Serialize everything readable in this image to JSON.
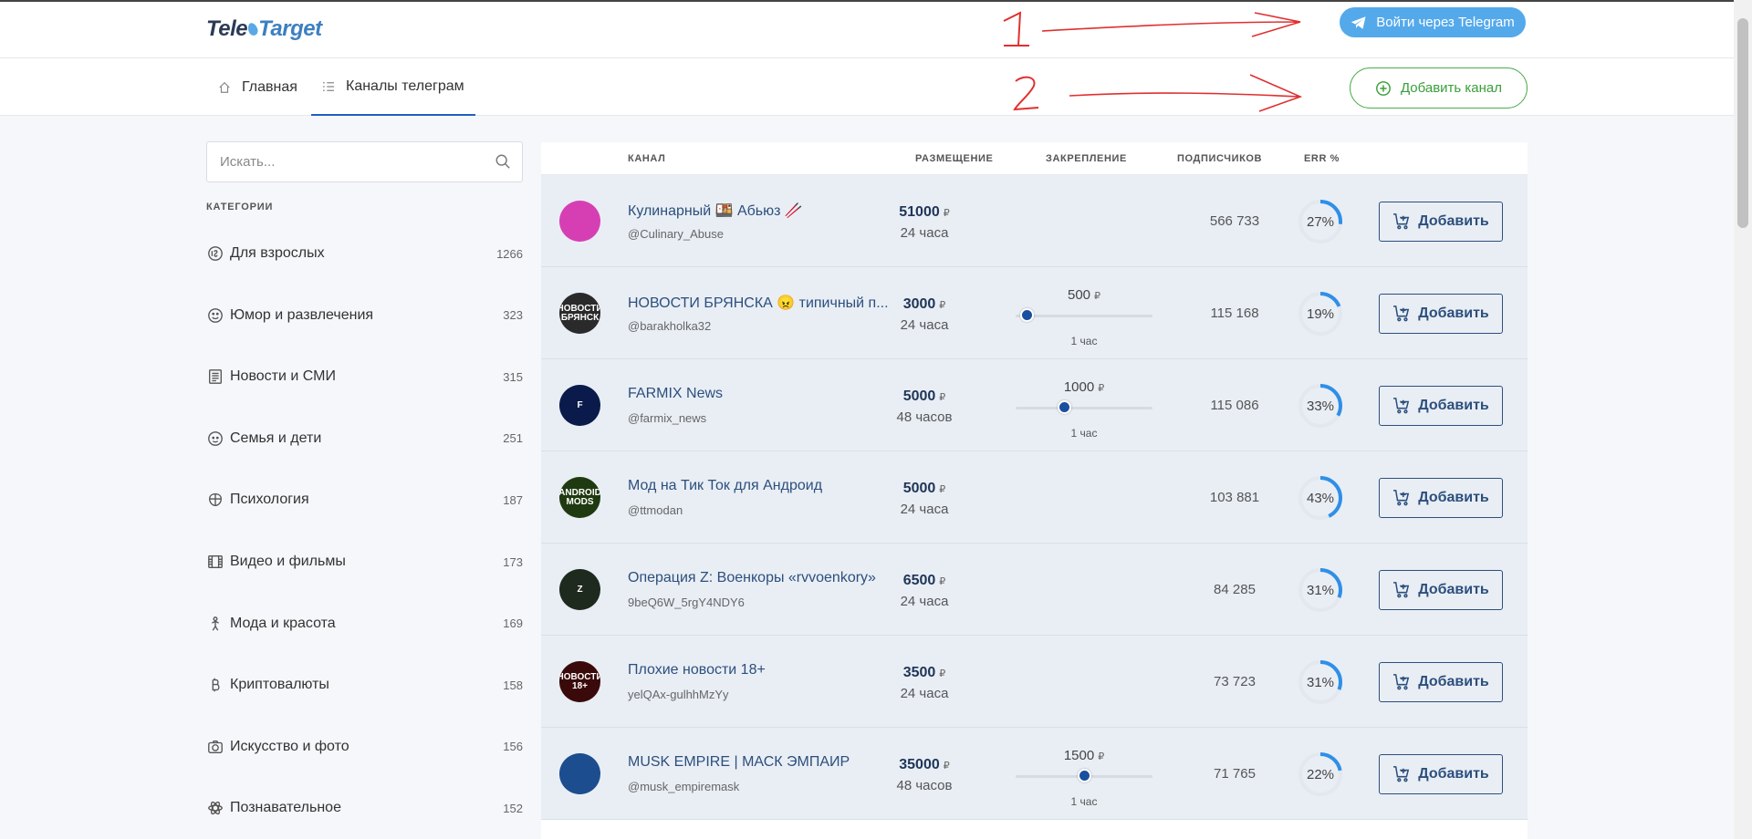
{
  "header": {
    "logo_part1": "Tele",
    "logo_part2": "Target",
    "login_button": "Войти через Telegram"
  },
  "nav": {
    "home": "Главная",
    "channels": "Каналы телеграм",
    "add_channel": "Добавить канал"
  },
  "search": {
    "placeholder": "Искать..."
  },
  "categories": {
    "title": "КАТЕГОРИИ",
    "items": [
      {
        "label": "Для взрослых",
        "count": "1266",
        "icon": "adult-18-icon"
      },
      {
        "label": "Юмор и развлечения",
        "count": "323",
        "icon": "smile-icon"
      },
      {
        "label": "Новости и СМИ",
        "count": "315",
        "icon": "newspaper-icon"
      },
      {
        "label": "Семья и дети",
        "count": "251",
        "icon": "baby-face-icon"
      },
      {
        "label": "Психология",
        "count": "187",
        "icon": "brain-icon"
      },
      {
        "label": "Видео и фильмы",
        "count": "173",
        "icon": "film-icon"
      },
      {
        "label": "Мода и красота",
        "count": "169",
        "icon": "person-icon"
      },
      {
        "label": "Криптовалюты",
        "count": "158",
        "icon": "bitcoin-icon"
      },
      {
        "label": "Искусство и фото",
        "count": "156",
        "icon": "camera-icon"
      },
      {
        "label": "Познавательное",
        "count": "152",
        "icon": "atom-icon"
      }
    ]
  },
  "table": {
    "columns": {
      "channel": "КАНАЛ",
      "placement": "РАЗМЕЩЕНИЕ",
      "pin": "ЗАКРЕПЛЕНИЕ",
      "subscribers": "ПОДПИСЧИКОВ",
      "err": "ERR %"
    },
    "add_label": "Добавить",
    "currency": "₽",
    "rows": [
      {
        "name": "Кулинарный 🍱 Абьюз 🥢",
        "handle": "@Culinary_Abuse",
        "price": "51000",
        "duration": "24 часа",
        "pin_price": "",
        "pin_duration": "",
        "pin_level": null,
        "subscribers": "566 733",
        "err": "27%",
        "err_value": 27,
        "avatar_color": "#d63fb4",
        "avatar_text": ""
      },
      {
        "name": "НОВОСТИ БРЯНСКА 😠 типичный п...",
        "handle": "@barakholka32",
        "price": "3000",
        "duration": "24 часа",
        "pin_price": "500",
        "pin_duration": "1 час",
        "pin_level": 0.08,
        "subscribers": "115 168",
        "err": "19%",
        "err_value": 19,
        "avatar_color": "#2a2a2a",
        "avatar_text": "НОВОСТИ БРЯНСК"
      },
      {
        "name": "FARMIX News",
        "handle": "@farmix_news",
        "price": "5000",
        "duration": "48 часов",
        "pin_price": "1000",
        "pin_duration": "1 час",
        "pin_level": 0.35,
        "subscribers": "115 086",
        "err": "33%",
        "err_value": 33,
        "avatar_color": "#0a1a4a",
        "avatar_text": "F"
      },
      {
        "name": "Мод на Тик Ток для Андроид",
        "handle": "@ttmodan",
        "price": "5000",
        "duration": "24 часа",
        "pin_price": "",
        "pin_duration": "",
        "pin_level": null,
        "subscribers": "103 881",
        "err": "43%",
        "err_value": 43,
        "avatar_color": "#1f3a10",
        "avatar_text": "ANDROID MODS"
      },
      {
        "name": "Операция Z: Военкоры «rvvoenkory»",
        "handle": "9beQ6W_5rgY4NDY6",
        "price": "6500",
        "duration": "24 часа",
        "pin_price": "",
        "pin_duration": "",
        "pin_level": null,
        "subscribers": "84 285",
        "err": "31%",
        "err_value": 31,
        "avatar_color": "#1e2a1e",
        "avatar_text": "Z"
      },
      {
        "name": "Плохие новости 18+",
        "handle": "yelQAx-gulhhMzYy",
        "price": "3500",
        "duration": "24 часа",
        "pin_price": "",
        "pin_duration": "",
        "pin_level": null,
        "subscribers": "73 723",
        "err": "31%",
        "err_value": 31,
        "avatar_color": "#3a0a0a",
        "avatar_text": "НОВОСТИ 18+"
      },
      {
        "name": "MUSK EMPIRE | МАСК ЭМПАИР",
        "handle": "@musk_empiremask",
        "price": "35000",
        "duration": "48 часов",
        "pin_price": "1500",
        "pin_duration": "1 час",
        "pin_level": 0.5,
        "subscribers": "71 765",
        "err": "22%",
        "err_value": 22,
        "avatar_color": "#1b4d8f",
        "avatar_text": ""
      }
    ]
  },
  "colors": {
    "accent": "#2c4f7c",
    "telegram": "#54a9eb",
    "add_channel": "#4cae4c",
    "err_ring": "#2f8fe8",
    "annotation": "#e03030"
  }
}
